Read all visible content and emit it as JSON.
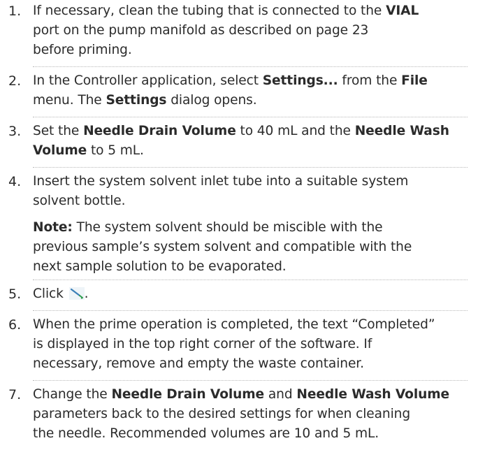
{
  "heading_fragment": "",
  "steps": [
    {
      "number": "1.",
      "line1_pre": "If necessary, clean the tubing that is connected to the ",
      "line1_bold": "VIAL",
      "line2": "port on the pump manifold as described on page 23",
      "line3": "before priming."
    },
    {
      "number": "2.",
      "pre": "In the Controller application, select ",
      "bold1": "Settings...",
      "mid": " from the ",
      "bold2": "File",
      "line2_pre": "menu. The ",
      "bold3": "Settings",
      "line2_post": " dialog opens."
    },
    {
      "number": "3.",
      "pre": "Set the ",
      "bold1": "Needle Drain Volume",
      "mid": " to 40 mL and the ",
      "bold2": "Needle Wash",
      "bold3": "Volume",
      "post": " to 5 mL."
    },
    {
      "number": "4.",
      "line1": "Insert the system solvent inlet tube into a suitable system",
      "line2": "solvent bottle.",
      "note_label": "Note:",
      "note_line1": " The system solvent should be miscible with the",
      "note_line2": "previous sample’s system solvent and compatible with the",
      "note_line3": "next sample solution to be evaporated."
    },
    {
      "number": "5.",
      "pre": "Click ",
      "icon": "prime-needle-icon",
      "post": "."
    },
    {
      "number": "6.",
      "line1": "When the prime operation is completed, the text “Completed”",
      "line2": "is displayed in the top right corner of the software. If",
      "line3": "necessary, remove and empty the waste container."
    },
    {
      "number": "7.",
      "pre": "Change the ",
      "bold1": "Needle Drain Volume",
      "mid": " and ",
      "bold2": "Needle Wash Volume",
      "line2": "parameters back to the desired settings for when cleaning",
      "line3": "the needle. Recommended volumes are 10 and 5 mL."
    }
  ],
  "colors": {
    "text": "#2b2b2b",
    "rule": "#b8b8b8",
    "icon_needle": "#3a7fb8"
  }
}
